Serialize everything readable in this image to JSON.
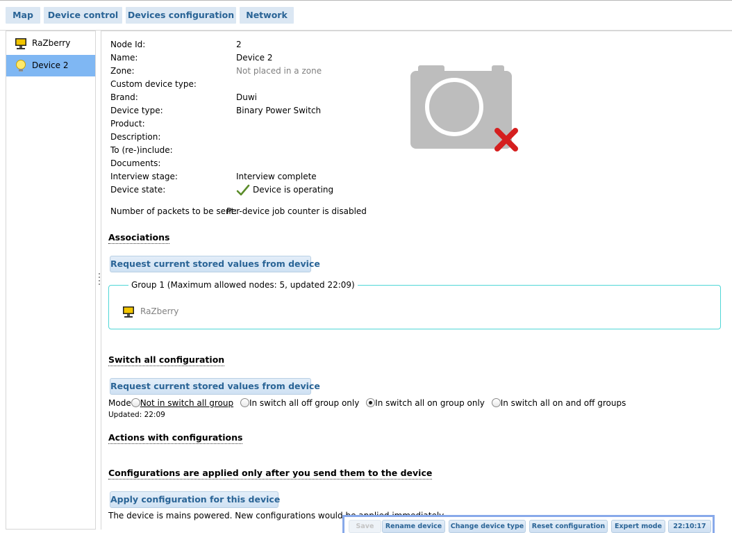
{
  "tabs": [
    {
      "label": "Map"
    },
    {
      "label": "Device control"
    },
    {
      "label": "Devices configuration"
    },
    {
      "label": "Network"
    }
  ],
  "sidebar": {
    "items": [
      {
        "label": "RaZberry",
        "icon": "computer-icon",
        "active": false
      },
      {
        "label": "Device 2",
        "icon": "lightbulb-icon",
        "active": true
      }
    ]
  },
  "details": {
    "node_id": {
      "key": "Node Id:",
      "value": "2"
    },
    "name": {
      "key": "Name:",
      "value": "Device 2"
    },
    "zone": {
      "key": "Zone:",
      "value": "Not placed in a zone"
    },
    "custom_type": {
      "key": "Custom device type:",
      "value": ""
    },
    "brand": {
      "key": "Brand:",
      "value": "Duwi"
    },
    "device_type": {
      "key": "Device type:",
      "value": "Binary Power Switch"
    },
    "product": {
      "key": "Product:",
      "value": ""
    },
    "description": {
      "key": "Description:",
      "value": ""
    },
    "reinclude": {
      "key": "To (re-)include:",
      "value": ""
    },
    "documents": {
      "key": "Documents:",
      "value": ""
    },
    "interview_stage": {
      "key": "Interview stage:",
      "value": "Interview complete"
    },
    "device_state": {
      "key": "Device state:",
      "value": "Device is operating"
    },
    "packets": {
      "key": "Number of packets to be sent:",
      "value": "Per-device job counter is disabled"
    }
  },
  "image": {
    "icon": "camera-missing-icon"
  },
  "associations": {
    "heading": "Associations",
    "request_label": "Request current stored values from device",
    "group_legend": "Group 1 (Maximum allowed nodes: 5, updated 22:09)",
    "group_member": "RaZberry"
  },
  "switch_all": {
    "heading": "Switch all configuration",
    "request_label": "Request current stored values from device",
    "mode_label": "Mode",
    "options": [
      {
        "label": "Not in switch all group",
        "checked": false
      },
      {
        "label": "In switch all off group only",
        "checked": false
      },
      {
        "label": "In switch all on group only",
        "checked": true
      },
      {
        "label": "In switch all on and off groups",
        "checked": false
      }
    ],
    "updated": "Updated: 22:09"
  },
  "actions": {
    "heading": "Actions with configurations",
    "note_heading": "Configurations are applied only after you send them to the device",
    "apply_label": "Apply configuration for this device",
    "footer_text": "The device is mains powered. New configurations would be applied immediately."
  },
  "toolbar": {
    "save": "Save",
    "rename": "Rename device",
    "change_type": "Change device type",
    "reset": "Reset configuration",
    "expert": "Expert mode",
    "time": "22:10:17"
  },
  "colors": {
    "tab_bg": "#dbe7f3",
    "tab_text": "#2a6496",
    "active_item": "#7fb7f3",
    "group_border": "#4fd6d6",
    "toolbar_border": "#88a9ea"
  }
}
